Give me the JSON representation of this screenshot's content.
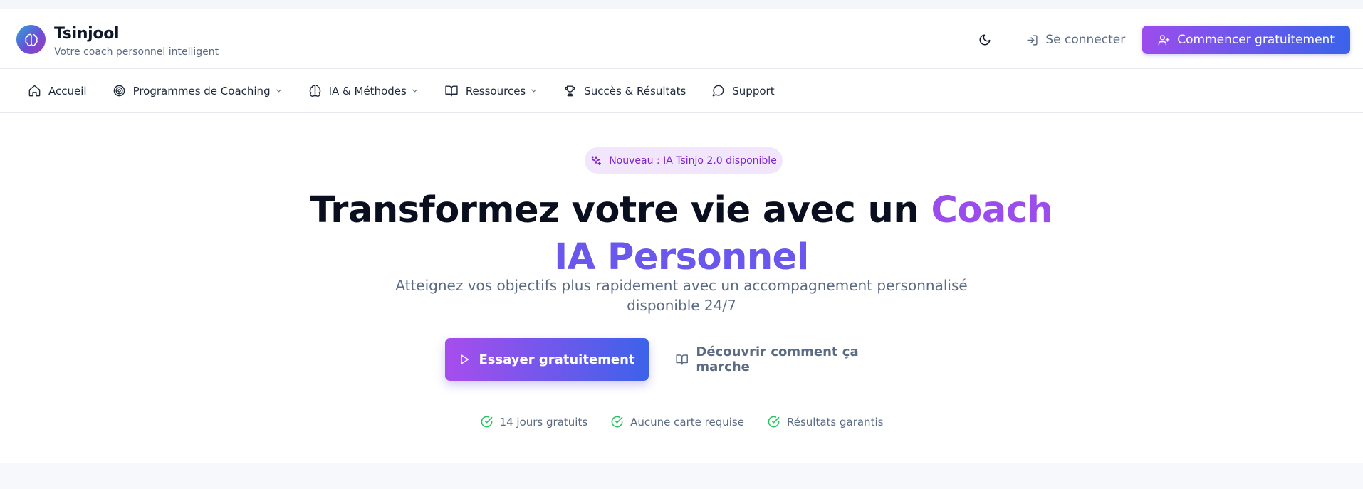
{
  "brand": {
    "name": "Tsinjool",
    "tagline": "Votre coach personnel intelligent",
    "logo_icon": "brain-icon"
  },
  "header": {
    "theme_toggle_icon": "moon-icon",
    "login_label": "Se connecter",
    "cta_label": "Commencer gratuitement"
  },
  "nav": {
    "items": [
      {
        "label": "Accueil",
        "icon": "home-icon",
        "dropdown": false
      },
      {
        "label": "Programmes de Coaching",
        "icon": "target-icon",
        "dropdown": true
      },
      {
        "label": "IA & Méthodes",
        "icon": "brain-icon",
        "dropdown": true
      },
      {
        "label": "Ressources",
        "icon": "book-icon",
        "dropdown": true
      },
      {
        "label": "Succès & Résultats",
        "icon": "trophy-icon",
        "dropdown": false
      },
      {
        "label": "Support",
        "icon": "chat-icon",
        "dropdown": false
      }
    ]
  },
  "hero": {
    "badge": "Nouveau : IA Tsinjo 2.0 disponible",
    "headline_part1": "Transformez votre vie avec un ",
    "headline_accent1": "Coach",
    "headline_accent2": "IA Personnel",
    "subtitle": "Atteignez vos objectifs plus rapidement avec un accompagnement personnalisé disponible 24/7",
    "primary_button": "Essayer gratuitement",
    "secondary_button": "Découvrir comment ça marche",
    "features": [
      "14 jours gratuits",
      "Aucune carte requise",
      "Résultats garantis"
    ]
  },
  "colors": {
    "accent_purple": "#9b4dec",
    "accent_blue": "#3a63ea",
    "check_green": "#22c55e",
    "muted_text": "#5b6b84"
  }
}
